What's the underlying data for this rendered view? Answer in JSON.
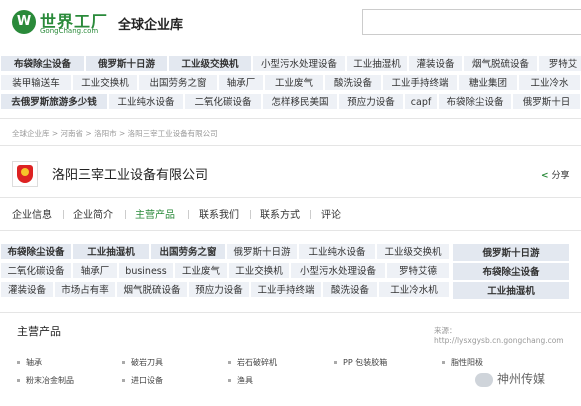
{
  "header": {
    "logo_mark": "W",
    "logo_title": "世界工厂",
    "logo_sub": "GongChang.com",
    "site_title": "全球企业库",
    "search_placeholder": ""
  },
  "kw_rows": [
    [
      "布袋除尘设备",
      "俄罗斯十日游",
      "工业级交换机",
      "小型污水处理设备",
      "工业抽湿机",
      "灌装设备",
      "烟气脱硫设备",
      "罗特艾"
    ],
    [
      "装甲输送车",
      "工业交换机",
      "出国劳务之窗",
      "轴承厂",
      "工业废气",
      "酸洗设备",
      "工业手持终端",
      "糖业集团",
      "工业冷水"
    ],
    [
      "去俄罗斯旅游多少钱",
      "工业纯水设备",
      "二氧化碳设备",
      "怎样移民美国",
      "预应力设备",
      "capf",
      "布袋除尘设备",
      "俄罗斯十日"
    ]
  ],
  "breadcrumb": "全球企业库 > 河南省 > 洛阳市 > 洛阳三宰工业设备有限公司",
  "company": {
    "name": "洛阳三宰工业设备有限公司",
    "share": "分享"
  },
  "tabs": [
    "企业信息",
    "企业简介",
    "主营产品",
    "联系我们",
    "联系方式",
    "评论"
  ],
  "kw_rows2": [
    [
      "布袋除尘设备",
      "工业抽湿机",
      "出国劳务之窗",
      "俄罗斯十日游",
      "工业纯水设备",
      "工业级交换机"
    ],
    [
      "二氧化碳设备",
      "轴承厂",
      "business",
      "工业废气",
      "工业交换机",
      "小型污水处理设备",
      "罗特艾德"
    ],
    [
      "灌装设备",
      "市场占有率",
      "烟气脱硫设备",
      "预应力设备",
      "工业手持终端",
      "酸洗设备",
      "工业冷水机"
    ]
  ],
  "side_kw": [
    "俄罗斯十日游",
    "布袋除尘设备",
    "工业抽湿机"
  ],
  "products": {
    "title": "主营产品",
    "source": "来源：http://lysxgysb.cn.gongchang.com",
    "items": [
      "轴承",
      "破岩刀具",
      "岩石破碎机",
      "PP 包装胶箱",
      "脂性阳极",
      "粉末冶金制品",
      "进口设备",
      "渔具"
    ]
  },
  "watermark": "神州传媒"
}
